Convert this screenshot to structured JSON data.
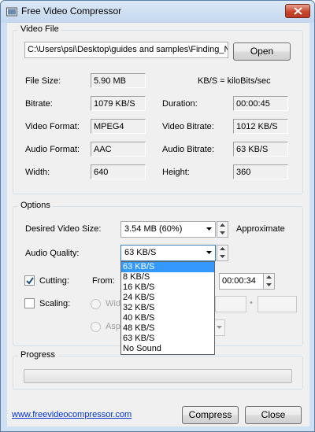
{
  "window": {
    "title": "Free Video Compressor"
  },
  "video_file": {
    "legend": "Video File",
    "path": "C:\\Users\\psi\\Desktop\\guides and samples\\Finding_N",
    "open_label": "Open",
    "file_size_label": "File Size:",
    "file_size": "5.90 MB",
    "kbs_note": "KB/S = kiloBits/sec",
    "bitrate_label": "Bitrate:",
    "bitrate": "1079 KB/S",
    "duration_label": "Duration:",
    "duration": "00:00:45",
    "video_format_label": "Video Format:",
    "video_format": "MPEG4",
    "video_bitrate_label": "Video Bitrate:",
    "video_bitrate": "1012 KB/S",
    "audio_format_label": "Audio Format:",
    "audio_format": "AAC",
    "audio_bitrate_label": "Audio Bitrate:",
    "audio_bitrate": "63 KB/S",
    "width_label": "Width:",
    "width": "640",
    "height_label": "Height:",
    "height": "360"
  },
  "options": {
    "legend": "Options",
    "desired_size_label": "Desired Video Size:",
    "desired_size": "3.54 MB (60%)",
    "approximate": "Approximate",
    "audio_quality_label": "Audio Quality:",
    "audio_quality": "63 KB/S",
    "audio_options": [
      "63 KB/S",
      "8 KB/S",
      "16 KB/S",
      "24 KB/S",
      "32 KB/S",
      "40 KB/S",
      "48 KB/S",
      "63 KB/S",
      "No Sound"
    ],
    "cutting_label": "Cutting:",
    "from_label": "From:",
    "cut_to": "00:00:34",
    "scaling_label": "Scaling:",
    "width_radio_label": "Wid",
    "aspect_radio_label": "Asp",
    "times_sign": "•"
  },
  "progress": {
    "legend": "Progress",
    "value": 0
  },
  "footer": {
    "website": "www.freevideocompressor.com",
    "compress_label": "Compress",
    "close_label": "Close"
  },
  "colors": {
    "accent": "#3399ff",
    "link": "#0033cc"
  }
}
